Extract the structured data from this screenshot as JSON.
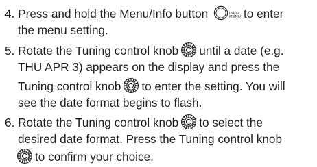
{
  "steps": [
    {
      "number": "4.",
      "lines": [
        "Press and hold the Menu/Info button",
        "to enter",
        "the menu setting."
      ],
      "icon_caption_top": "INFO",
      "icon_caption_bottom": "MENU"
    },
    {
      "number": "5.",
      "lines": [
        "Rotate the Tuning control knob",
        "until a date (e.g.",
        "THU APR 3) appears on the display and press the",
        "Tuning control knob",
        "to enter the setting. You will",
        "see the date format begins to flash."
      ]
    },
    {
      "number": "6.",
      "lines": [
        "Rotate the Tuning control knob",
        "to select the",
        "desired date format. Press the Tuning control knob",
        "to confirm your choice."
      ]
    }
  ],
  "icons": {
    "menu_info_button": "menu-info-button-icon",
    "tuning_knob": "tuning-knob-icon"
  },
  "colors": {
    "text": "#231f20"
  }
}
